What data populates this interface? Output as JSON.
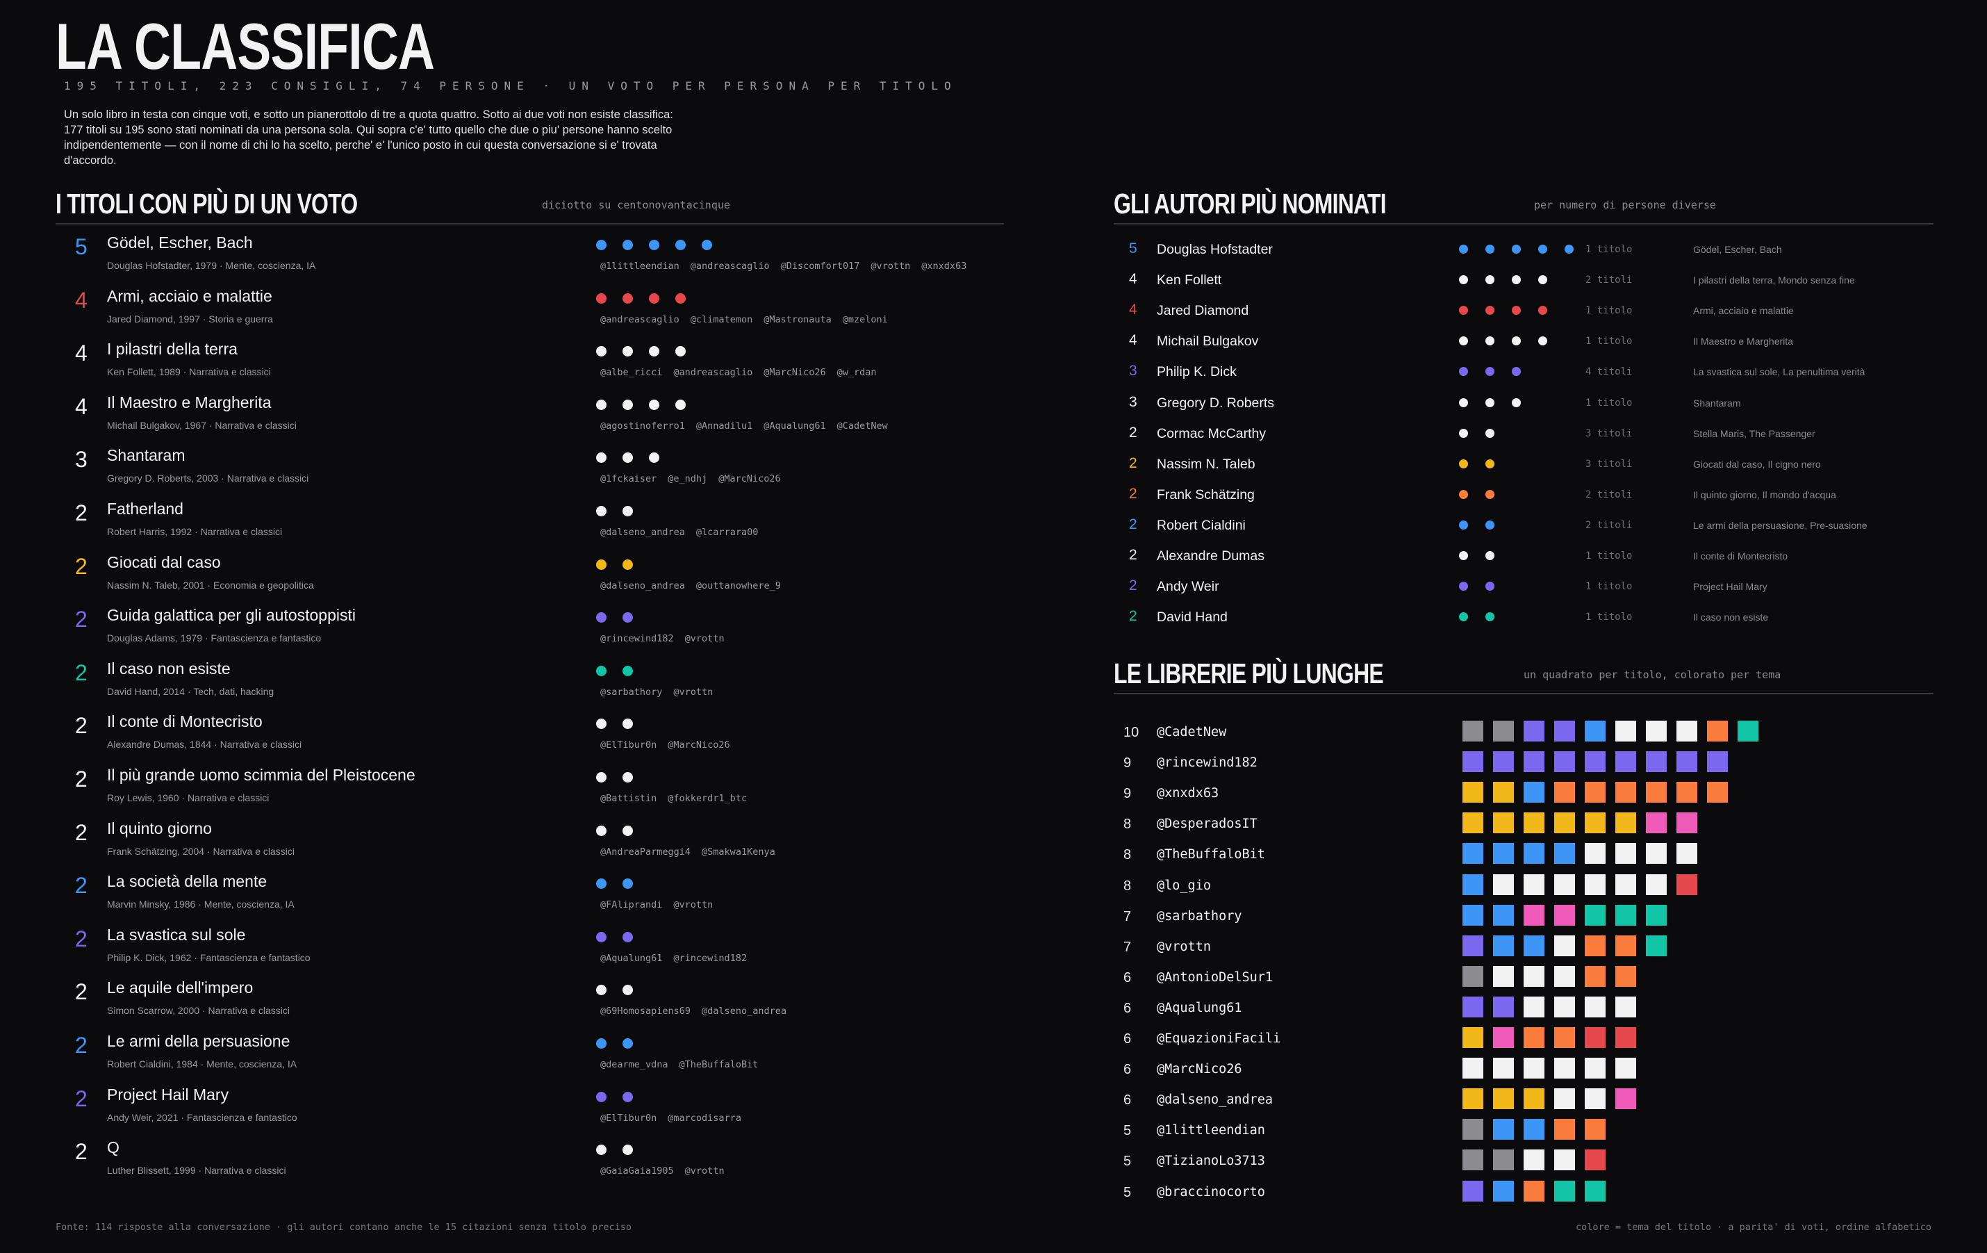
{
  "header": {
    "title": "LA CLASSIFICA",
    "subtitle": "195 TITOLI, 223 CONSIGLI, 74 PERSONE   ·   UN VOTO PER PERSONA PER TITOLO",
    "intro": "Un solo libro in testa con cinque voti, e sotto un pianerottolo di tre a quota quattro. Sotto ai due voti non esiste classifica: 177 titoli su 195 sono stati nominati da una persona sola. Qui sopra c'e' tutto quello che due o piu' persone hanno scelto indipendentemente — con il nome di chi lo ha scelto, perche' e' l'unico posto in cui questa conversazione si e' trovata d'accordo."
  },
  "colors": {
    "background": "#0b0b0e",
    "white": "#f2f2f2",
    "blue": "#3d96f5",
    "red": "#e5484d",
    "yellow": "#f2b81a",
    "purple": "#7b68ee",
    "teal": "#12c5a6",
    "orange": "#f97c3c",
    "pink": "#ef5ab8",
    "gray": "#8c8c90"
  },
  "titles_section": {
    "title": "I TITOLI CON PIÙ DI UN VOTO",
    "note": "diciotto su centonovantacinque",
    "items": [
      {
        "count": "5",
        "name": "Gödel, Escher, Bach",
        "meta": "Douglas Hofstadter, 1979   ·   Mente, coscienza, IA",
        "color": "blue",
        "users": [
          "@1littleendian",
          "@andreascaglio",
          "@Discomfort017",
          "@vrottn",
          "@xnxdx63"
        ]
      },
      {
        "count": "4",
        "name": "Armi, acciaio e malattie",
        "meta": "Jared Diamond, 1997   ·   Storia e guerra",
        "color": "red",
        "users": [
          "@andreascaglio",
          "@climatemon",
          "@Mastronauta",
          "@mzeloni"
        ]
      },
      {
        "count": "4",
        "name": "I pilastri della terra",
        "meta": "Ken Follett, 1989   ·   Narrativa e classici",
        "color": "white",
        "users": [
          "@albe_ricci",
          "@andreascaglio",
          "@MarcNico26",
          "@w_rdan"
        ]
      },
      {
        "count": "4",
        "name": "Il Maestro e Margherita",
        "meta": "Michail Bulgakov, 1967   ·   Narrativa e classici",
        "color": "white",
        "users": [
          "@agostinoferro1",
          "@Annadilu1",
          "@Aqualung61",
          "@CadetNew"
        ]
      },
      {
        "count": "3",
        "name": "Shantaram",
        "meta": "Gregory D. Roberts, 2003   ·   Narrativa e classici",
        "color": "white",
        "users": [
          "@1fckaiser",
          "@e_ndhj",
          "@MarcNico26"
        ]
      },
      {
        "count": "2",
        "name": "Fatherland",
        "meta": "Robert Harris, 1992   ·   Narrativa e classici",
        "color": "white",
        "users": [
          "@dalseno_andrea",
          "@lcarrara00"
        ]
      },
      {
        "count": "2",
        "name": "Giocati dal caso",
        "meta": "Nassim N. Taleb, 2001   ·   Economia e geopolitica",
        "color": "yellow",
        "users": [
          "@dalseno_andrea",
          "@outtanowhere_9"
        ]
      },
      {
        "count": "2",
        "name": "Guida galattica per gli autostoppisti",
        "meta": "Douglas Adams, 1979   ·   Fantascienza e fantastico",
        "color": "purple",
        "users": [
          "@rincewind182",
          "@vrottn"
        ]
      },
      {
        "count": "2",
        "name": "Il caso non esiste",
        "meta": "David Hand, 2014   ·   Tech, dati, hacking",
        "color": "teal",
        "users": [
          "@sarbathory",
          "@vrottn"
        ]
      },
      {
        "count": "2",
        "name": "Il conte di Montecristo",
        "meta": "Alexandre Dumas, 1844   ·   Narrativa e classici",
        "color": "white",
        "users": [
          "@ElTibur0n",
          "@MarcNico26"
        ]
      },
      {
        "count": "2",
        "name": "Il più grande uomo scimmia del Pleistocene",
        "meta": "Roy Lewis, 1960   ·   Narrativa e classici",
        "color": "white",
        "users": [
          "@Battistin",
          "@fokkerdr1_btc"
        ]
      },
      {
        "count": "2",
        "name": "Il quinto giorno",
        "meta": "Frank Schätzing, 2004   ·   Narrativa e classici",
        "color": "white",
        "users": [
          "@AndreaParmeggi4",
          "@Smakwa1Kenya"
        ]
      },
      {
        "count": "2",
        "name": "La società della mente",
        "meta": "Marvin Minsky, 1986   ·   Mente, coscienza, IA",
        "color": "blue",
        "users": [
          "@FAliprandi",
          "@vrottn"
        ]
      },
      {
        "count": "2",
        "name": "La svastica sul sole",
        "meta": "Philip K. Dick, 1962   ·   Fantascienza e fantastico",
        "color": "purple",
        "users": [
          "@Aqualung61",
          "@rincewind182"
        ]
      },
      {
        "count": "2",
        "name": "Le aquile dell'impero",
        "meta": "Simon Scarrow, 2000   ·   Narrativa e classici",
        "color": "white",
        "users": [
          "@69Homosapiens69",
          "@dalseno_andrea"
        ]
      },
      {
        "count": "2",
        "name": "Le armi della persuasione",
        "meta": "Robert Cialdini, 1984   ·   Mente, coscienza, IA",
        "color": "blue",
        "users": [
          "@dearme_vdna",
          "@TheBuffaloBit"
        ]
      },
      {
        "count": "2",
        "name": "Project Hail Mary",
        "meta": "Andy Weir, 2021   ·   Fantascienza e fantastico",
        "color": "purple",
        "users": [
          "@ElTibur0n",
          "@marcodisarra"
        ]
      },
      {
        "count": "2",
        "name": "Q",
        "meta": "Luther Blissett, 1999   ·   Narrativa e classici",
        "color": "white",
        "users": [
          "@GaiaGaia1905",
          "@vrottn"
        ]
      }
    ]
  },
  "authors_section": {
    "title": "GLI AUTORI PIÙ NOMINATI",
    "note": "per numero di persone diverse",
    "items": [
      {
        "count": "5",
        "name": "Douglas Hofstadter",
        "color": "blue",
        "titles": "1 titolo",
        "books": "Gödel, Escher, Bach"
      },
      {
        "count": "4",
        "name": "Ken Follett",
        "color": "white",
        "titles": "2 titoli",
        "books": "I pilastri della terra, Mondo senza fine"
      },
      {
        "count": "4",
        "name": "Jared Diamond",
        "color": "red",
        "titles": "1 titolo",
        "books": "Armi, acciaio e malattie"
      },
      {
        "count": "4",
        "name": "Michail Bulgakov",
        "color": "white",
        "titles": "1 titolo",
        "books": "Il Maestro e Margherita"
      },
      {
        "count": "3",
        "name": "Philip K. Dick",
        "color": "purple",
        "titles": "4 titoli",
        "books": "La svastica sul sole, La penultima verità"
      },
      {
        "count": "3",
        "name": "Gregory D. Roberts",
        "color": "white",
        "titles": "1 titolo",
        "books": "Shantaram"
      },
      {
        "count": "2",
        "name": "Cormac McCarthy",
        "color": "white",
        "titles": "3 titoli",
        "books": "Stella Maris, The Passenger"
      },
      {
        "count": "2",
        "name": "Nassim N. Taleb",
        "color": "yellow",
        "titles": "3 titoli",
        "books": "Giocati dal caso, Il cigno nero"
      },
      {
        "count": "2",
        "name": "Frank Schätzing",
        "color": "orange",
        "titles": "2 titoli",
        "books": "Il quinto giorno, Il mondo d'acqua"
      },
      {
        "count": "2",
        "name": "Robert Cialdini",
        "color": "blue",
        "titles": "2 titoli",
        "books": "Le armi della persuasione, Pre-suasione"
      },
      {
        "count": "2",
        "name": "Alexandre Dumas",
        "color": "white",
        "titles": "1 titolo",
        "books": "Il conte di Montecristo"
      },
      {
        "count": "2",
        "name": "Andy Weir",
        "color": "purple",
        "titles": "1 titolo",
        "books": "Project Hail Mary"
      },
      {
        "count": "2",
        "name": "David Hand",
        "color": "teal",
        "titles": "1 titolo",
        "books": "Il caso non esiste"
      }
    ]
  },
  "libraries_section": {
    "title": "LE LIBRERIE PIÙ LUNGHE",
    "note": "un quadrato per titolo, colorato per tema",
    "items": [
      {
        "count": "10",
        "user": "@CadetNew",
        "squares": [
          "gray",
          "gray",
          "purple",
          "purple",
          "blue",
          "white",
          "white",
          "white",
          "orange",
          "teal"
        ]
      },
      {
        "count": "9",
        "user": "@rincewind182",
        "squares": [
          "purple",
          "purple",
          "purple",
          "purple",
          "purple",
          "purple",
          "purple",
          "purple",
          "purple"
        ]
      },
      {
        "count": "9",
        "user": "@xnxdx63",
        "squares": [
          "yellow",
          "yellow",
          "blue",
          "orange",
          "orange",
          "orange",
          "orange",
          "orange",
          "orange"
        ]
      },
      {
        "count": "8",
        "user": "@DesperadosIT",
        "squares": [
          "yellow",
          "yellow",
          "yellow",
          "yellow",
          "yellow",
          "yellow",
          "pink",
          "pink"
        ]
      },
      {
        "count": "8",
        "user": "@TheBuffaloBit",
        "squares": [
          "blue",
          "blue",
          "blue",
          "blue",
          "white",
          "white",
          "white",
          "white"
        ]
      },
      {
        "count": "8",
        "user": "@lo_gio",
        "squares": [
          "blue",
          "white",
          "white",
          "white",
          "white",
          "white",
          "white",
          "red"
        ]
      },
      {
        "count": "7",
        "user": "@sarbathory",
        "squares": [
          "blue",
          "blue",
          "pink",
          "pink",
          "teal",
          "teal",
          "teal"
        ]
      },
      {
        "count": "7",
        "user": "@vrottn",
        "squares": [
          "purple",
          "blue",
          "blue",
          "white",
          "orange",
          "orange",
          "teal"
        ]
      },
      {
        "count": "6",
        "user": "@AntonioDelSur1",
        "squares": [
          "gray",
          "white",
          "white",
          "white",
          "orange",
          "orange"
        ]
      },
      {
        "count": "6",
        "user": "@Aqualung61",
        "squares": [
          "purple",
          "purple",
          "white",
          "white",
          "white",
          "white"
        ]
      },
      {
        "count": "6",
        "user": "@EquazioniFacili",
        "squares": [
          "yellow",
          "pink",
          "orange",
          "orange",
          "red",
          "red"
        ]
      },
      {
        "count": "6",
        "user": "@MarcNico26",
        "squares": [
          "white",
          "white",
          "white",
          "white",
          "white",
          "white"
        ]
      },
      {
        "count": "6",
        "user": "@dalseno_andrea",
        "squares": [
          "yellow",
          "yellow",
          "yellow",
          "white",
          "white",
          "pink"
        ]
      },
      {
        "count": "5",
        "user": "@1littleendian",
        "squares": [
          "gray",
          "blue",
          "blue",
          "orange",
          "orange"
        ]
      },
      {
        "count": "5",
        "user": "@TizianoLo3713",
        "squares": [
          "gray",
          "gray",
          "white",
          "white",
          "red"
        ]
      },
      {
        "count": "5",
        "user": "@braccinocorto",
        "squares": [
          "purple",
          "blue",
          "orange",
          "teal",
          "teal"
        ]
      }
    ]
  },
  "footer": {
    "left": "Fonte: 114 risposte alla conversazione  ·  gli autori contano anche le 15 citazioni senza titolo preciso",
    "right": "colore = tema del titolo  ·  a parita' di voti, ordine alfabetico"
  }
}
